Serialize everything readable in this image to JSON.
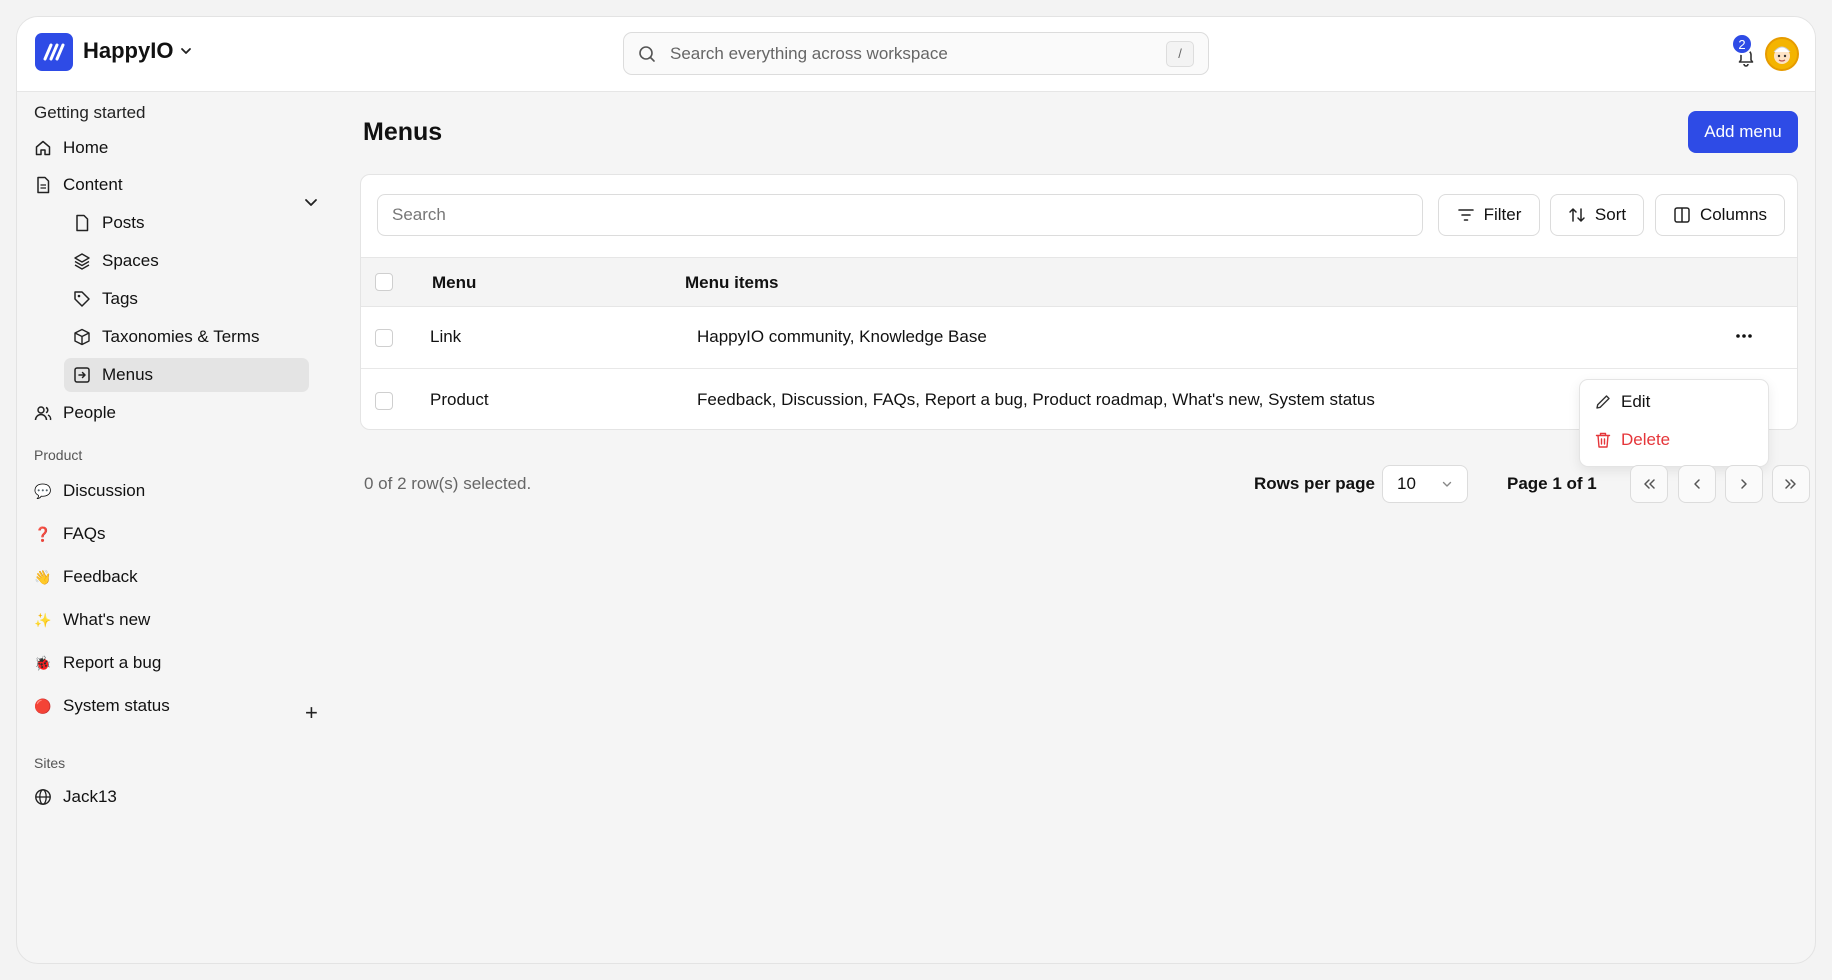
{
  "header": {
    "brand": "HappyIO",
    "search_placeholder": "Search everything across workspace",
    "search_shortcut": "/",
    "notification_count": "2"
  },
  "sidebar": {
    "getting_started": "Getting started",
    "home": "Home",
    "content": "Content",
    "content_items": [
      "Posts",
      "Spaces",
      "Tags",
      "Taxonomies & Terms",
      "Menus"
    ],
    "people": "People",
    "product_section": "Product",
    "product_items": [
      {
        "emoji": "💬",
        "label": "Discussion"
      },
      {
        "emoji": "❓",
        "label": "FAQs"
      },
      {
        "emoji": "👋",
        "label": "Feedback"
      },
      {
        "emoji": "✨",
        "label": "What's new"
      },
      {
        "emoji": "🐞",
        "label": "Report a bug"
      },
      {
        "emoji": "🔴",
        "label": "System status"
      }
    ],
    "sites_section": "Sites",
    "sites": [
      "Jack13"
    ]
  },
  "main": {
    "title": "Menus",
    "add_button": "Add menu",
    "search_placeholder": "Search",
    "filter_label": "Filter",
    "sort_label": "Sort",
    "columns_label": "Columns",
    "columns": [
      "Menu",
      "Menu items"
    ],
    "rows": [
      {
        "menu": "Link",
        "items": "HappyIO community, Knowledge Base"
      },
      {
        "menu": "Product",
        "items": "Feedback, Discussion, FAQs, Report a bug, Product roadmap, What's new, System status"
      }
    ],
    "row_menu": {
      "edit": "Edit",
      "delete": "Delete"
    },
    "selection_text": "0 of 2 row(s) selected.",
    "rows_per_page_label": "Rows per page",
    "rows_per_page_value": "10",
    "page_text": "Page 1 of 1"
  },
  "colors": {
    "accent": "#2e4be6",
    "danger": "#e5363a"
  }
}
